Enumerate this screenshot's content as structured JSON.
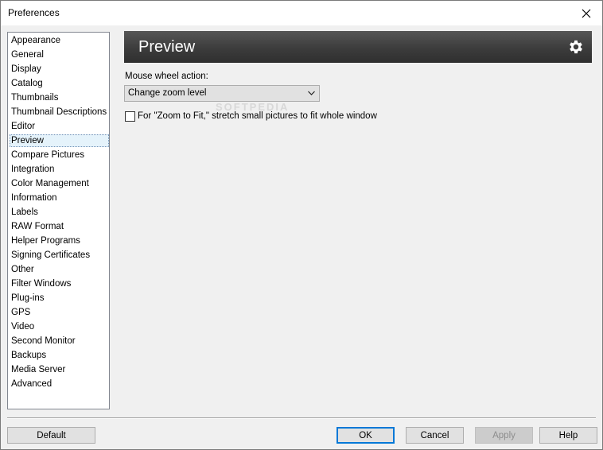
{
  "window": {
    "title": "Preferences"
  },
  "sidebar": {
    "items": [
      {
        "label": "Appearance"
      },
      {
        "label": "General"
      },
      {
        "label": "Display"
      },
      {
        "label": "Catalog"
      },
      {
        "label": "Thumbnails"
      },
      {
        "label": "Thumbnail Descriptions"
      },
      {
        "label": "Editor"
      },
      {
        "label": "Preview",
        "selected": true
      },
      {
        "label": "Compare Pictures"
      },
      {
        "label": "Integration"
      },
      {
        "label": "Color Management"
      },
      {
        "label": "Information"
      },
      {
        "label": "Labels"
      },
      {
        "label": "RAW Format"
      },
      {
        "label": "Helper Programs"
      },
      {
        "label": "Signing Certificates"
      },
      {
        "label": "Other"
      },
      {
        "label": "Filter Windows"
      },
      {
        "label": "Plug-ins"
      },
      {
        "label": "GPS"
      },
      {
        "label": "Video"
      },
      {
        "label": "Second Monitor"
      },
      {
        "label": "Backups"
      },
      {
        "label": "Media Server"
      },
      {
        "label": "Advanced"
      }
    ]
  },
  "panel": {
    "title": "Preview",
    "header_icon": "gear-icon",
    "mouse_wheel_label": "Mouse wheel action:",
    "mouse_wheel_value": "Change zoom level",
    "stretch_label": "For \"Zoom to Fit,\" stretch small pictures to fit whole window",
    "stretch_checked": false,
    "watermark": "SOFTPEDIA"
  },
  "buttons": {
    "default": "Default",
    "ok": "OK",
    "cancel": "Cancel",
    "apply": "Apply",
    "help": "Help"
  },
  "colors": {
    "header_band": "#3c3c3c",
    "selection": "#e5f3fb",
    "focus_border": "#0078d7"
  }
}
